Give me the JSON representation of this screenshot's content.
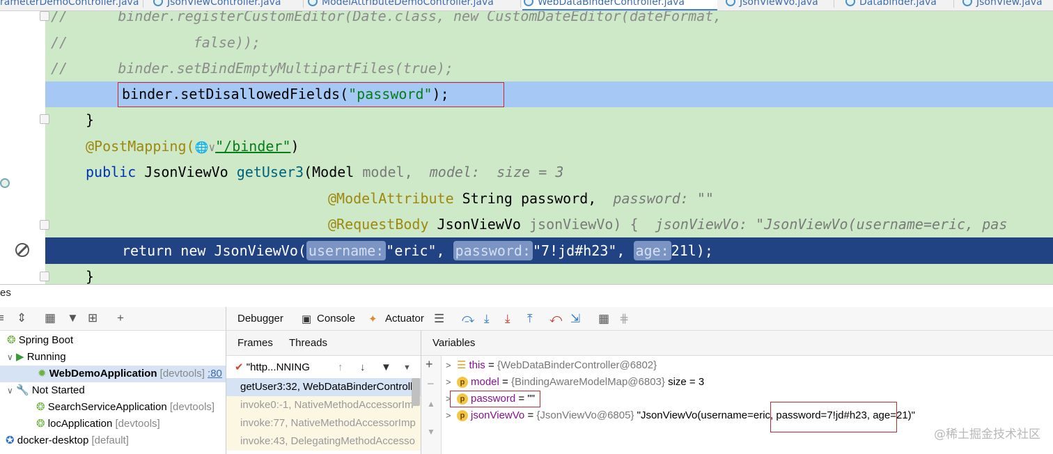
{
  "tabs": [
    {
      "label": "rameterDemoController.java"
    },
    {
      "label": "JsonViewController.java"
    },
    {
      "label": "ModelAttributeDemoController.java"
    },
    {
      "label": "WebDataBinderController.java"
    },
    {
      "label": "JsonViewVo.java"
    },
    {
      "label": "Databinder.java"
    },
    {
      "label": "JsonView.java"
    }
  ],
  "code": {
    "l1_comment": "//",
    "l1_text": "binder.registerCustomEditor(Date.class, new CustomDateEditor(dateFormat,",
    "l2_comment": "//",
    "l2_text": "false));",
    "l3_comment": "//",
    "l3_text": "binder.setBindEmptyMultipartFiles(true);",
    "l4_a": "binder.setDisallowedFields(",
    "l4_str": "\"password\"",
    "l4_b": ");",
    "l5": "}",
    "l6_ann": "@PostMapping(",
    "l6_icons": "🌐∨",
    "l6_str": "\"/binder\"",
    "l6_b": ")",
    "l7_kw": "public",
    "l7_type": "JsonViewVo",
    "l7_fn": "getUser3",
    "l7_a": "(Model",
    "l7_param": "model,",
    "l7_hint": "model:  size = 3",
    "l8_ann": "@ModelAttribute",
    "l8_a": "String password,",
    "l8_hint": "password: \"\"",
    "l9_ann": "@RequestBody",
    "l9_a": "JsonViewVo",
    "l9_param": "jsonViewVo) {",
    "l9_hint": "jsonViewVo: \"JsonViewVo(username=eric, pas",
    "l10_a": "return new JsonViewVo(",
    "l10_inlay1": "username:",
    "l10_v1": "\"eric\",",
    "l10_inlay2": "password:",
    "l10_v2": "\"7!jd#h23\",",
    "l10_inlay3": "age:",
    "l10_v3": "21l);",
    "l11": "}"
  },
  "services": {
    "title": "es",
    "tree": [
      {
        "label": "Spring Boot"
      },
      {
        "label": "Running"
      },
      {
        "label": "WebDemoApplication",
        "suffix": "[devtools]",
        "port": ":80"
      },
      {
        "label": "Not Started"
      },
      {
        "label": "SearchServiceApplication",
        "suffix": "[devtools]"
      },
      {
        "label": "locApplication",
        "suffix": "[devtools]"
      },
      {
        "label": "docker-desktop",
        "suffix": "[default]"
      }
    ]
  },
  "debugger": {
    "tab_debugger": "Debugger",
    "tab_console": "Console",
    "tab_actuator": "Actuator",
    "frames_label": "Frames",
    "threads_label": "Threads",
    "variables_label": "Variables",
    "thread_name": "\"http...NNING",
    "frames": [
      "getUser3:32, WebDataBinderControlle",
      "invoke0:-1, NativeMethodAccessorIm",
      "invoke:77, NativeMethodAccessorImp",
      "invoke:43, DelegatingMethodAccesso"
    ],
    "variables": [
      {
        "name": "this",
        "value": "{WebDataBinderController@6802}",
        "extra": ""
      },
      {
        "name": "model",
        "value": "{BindingAwareModelMap@6803}",
        "extra": "size = 3"
      },
      {
        "name": "password",
        "value": "\"\"",
        "extra": ""
      },
      {
        "name": "jsonViewVo",
        "value": "{JsonViewVo@6805}",
        "extra": "\"JsonViewVo(username=eric, password=7!jd#h23, age=21)\""
      }
    ]
  },
  "watermark": "@稀土掘金技术社区",
  "colors": {
    "editor_bg": "#cde9c8",
    "current_line": "#a6c8f5",
    "breakpoint_line": "#214283",
    "highlight_box": "#c8282d",
    "keyword": "#0033b3",
    "annotation": "#9e880d",
    "string": "#067d17"
  }
}
